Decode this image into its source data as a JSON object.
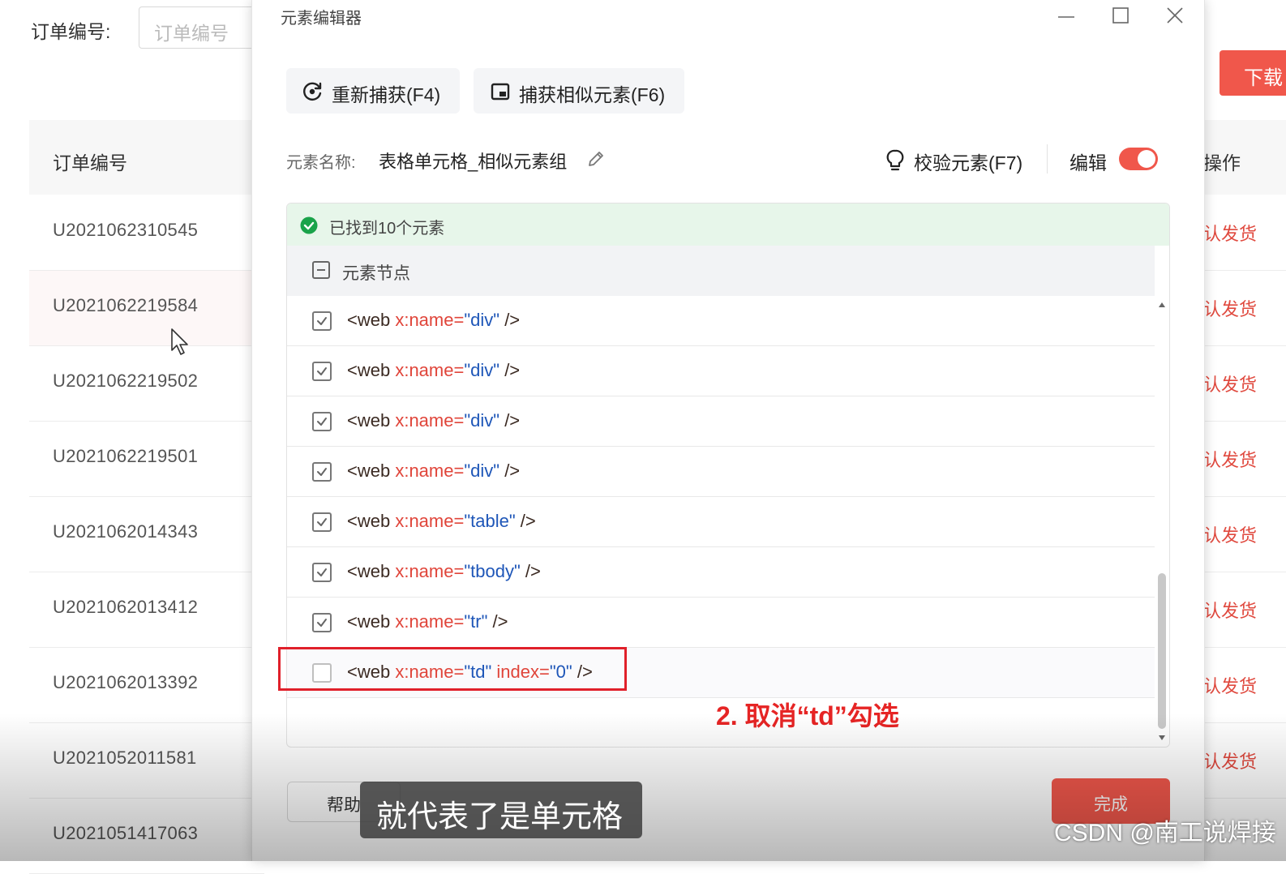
{
  "background": {
    "filter_label": "订单编号:",
    "filter_placeholder": "订单编号",
    "column_header": "订单编号",
    "order_ids": [
      "U2021062310545",
      "U2021062219584",
      "U2021062219502",
      "U2021062219501",
      "U2021062014343",
      "U2021062013412",
      "U2021062013392",
      "U2021052011581",
      "U2021051417063"
    ],
    "ops_header": "操作",
    "ops_cells": [
      "认发货",
      "认发货",
      "认发货",
      "认发货",
      "认发货",
      "认发货",
      "认发货",
      "认发货"
    ],
    "red_button": "下载"
  },
  "dialog": {
    "title": "元素编辑器",
    "recapture_button": "重新捕获(F4)",
    "capture_similar_button": "捕获相似元素(F6)",
    "element_name_label": "元素名称:",
    "element_name_value": "表格单元格_相似元素组",
    "verify_button": "校验元素(F7)",
    "edit_label": "编辑",
    "edit_toggle_on": true,
    "found_message": "已找到10个元素",
    "node_header": "元素节点",
    "nodes": [
      {
        "tag": "<web ",
        "attr": "x:name=",
        "value": "\"div\"",
        "attr2": "",
        "value2": "",
        "close": " />",
        "checked": true
      },
      {
        "tag": "<web ",
        "attr": "x:name=",
        "value": "\"div\"",
        "attr2": "",
        "value2": "",
        "close": " />",
        "checked": true
      },
      {
        "tag": "<web ",
        "attr": "x:name=",
        "value": "\"div\"",
        "attr2": "",
        "value2": "",
        "close": " />",
        "checked": true
      },
      {
        "tag": "<web ",
        "attr": "x:name=",
        "value": "\"div\"",
        "attr2": "",
        "value2": "",
        "close": " />",
        "checked": true
      },
      {
        "tag": "<web ",
        "attr": "x:name=",
        "value": "\"table\"",
        "attr2": "",
        "value2": "",
        "close": " />",
        "checked": true
      },
      {
        "tag": "<web ",
        "attr": "x:name=",
        "value": "\"tbody\"",
        "attr2": "",
        "value2": "",
        "close": " />",
        "checked": true
      },
      {
        "tag": "<web ",
        "attr": "x:name=",
        "value": "\"tr\"",
        "attr2": "",
        "value2": "",
        "close": " />",
        "checked": true
      },
      {
        "tag": "<web ",
        "attr": "x:name=",
        "value": "\"td\"",
        "attr2": " index=",
        "value2": "\"0\"",
        "close": " />",
        "checked": false
      }
    ],
    "help_button": "帮助",
    "done_button": "完成"
  },
  "annotation": "2. 取消“td”勾选",
  "subtitle": "就代表了是单元格",
  "watermark": "CSDN @南工说焊接",
  "colors": {
    "accent_red": "#f0574b",
    "highlight_red": "#e0202a",
    "success_green": "#1aa34a",
    "found_bg": "#e7f6ea",
    "code_value_blue": "#1e56b8",
    "code_attr_red": "#e0453a"
  }
}
